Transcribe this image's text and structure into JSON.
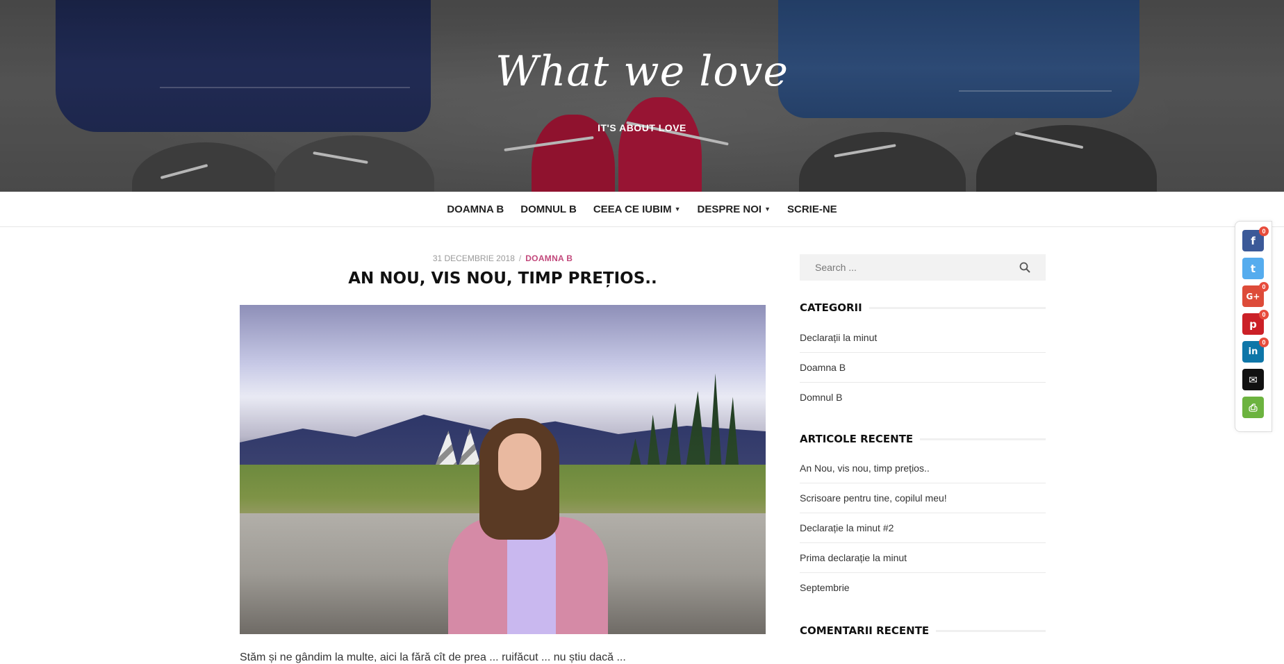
{
  "header": {
    "site_title": "What we love",
    "tagline": "IT'S ABOUT LOVE"
  },
  "nav": {
    "items": [
      {
        "label": "DOAMNA B",
        "has_dropdown": false
      },
      {
        "label": "DOMNUL B",
        "has_dropdown": false
      },
      {
        "label": "CEEA CE IUBIM",
        "has_dropdown": true
      },
      {
        "label": "DESPRE NOI",
        "has_dropdown": true
      },
      {
        "label": "SCRIE-NE",
        "has_dropdown": false
      }
    ]
  },
  "post": {
    "date": "31 DECEMBRIE 2018",
    "separator": "/",
    "category": "DOAMNA B",
    "title": "AN NOU, VIS NOU, TIMP PREȚIOS..",
    "excerpt": "Stăm și ne gândim la multe, aici la fără cît de prea ... ruifăcut ... nu știu dacă ..."
  },
  "sidebar": {
    "search_placeholder": "Search ...",
    "categories_title": "CATEGORII",
    "categories": [
      "Declarații la minut",
      "Doamna B",
      "Domnul B"
    ],
    "recent_title": "ARTICOLE RECENTE",
    "recent": [
      "An Nou, vis nou, timp prețios..",
      "Scrisoare pentru tine, copilul meu!",
      "Declarație la minut #2",
      "Prima declarație la minut",
      "Septembrie"
    ],
    "comments_title": "COMENTARII RECENTE"
  },
  "share": {
    "buttons": [
      {
        "network": "facebook",
        "icon": "facebook-icon",
        "glyph": "f",
        "color": "#3b5998",
        "count": "0"
      },
      {
        "network": "twitter",
        "icon": "twitter-icon",
        "glyph": "t",
        "color": "#55acee",
        "count": ""
      },
      {
        "network": "google-plus",
        "icon": "google-plus-icon",
        "glyph": "G+",
        "color": "#dd4b39",
        "count": "0"
      },
      {
        "network": "pinterest",
        "icon": "pinterest-icon",
        "glyph": "p",
        "color": "#cb2027",
        "count": "0"
      },
      {
        "network": "linkedin",
        "icon": "linkedin-icon",
        "glyph": "in",
        "color": "#0e76a8",
        "count": "0"
      },
      {
        "network": "email",
        "icon": "email-icon",
        "glyph": "✉",
        "color": "#111111",
        "count": ""
      },
      {
        "network": "print",
        "icon": "print-icon",
        "glyph": "⎙",
        "color": "#6cb33f",
        "count": ""
      }
    ]
  },
  "colors": {
    "accent": "#c2487b",
    "nav_text": "#222222",
    "sidebar_bg": "#f2f2f2"
  }
}
